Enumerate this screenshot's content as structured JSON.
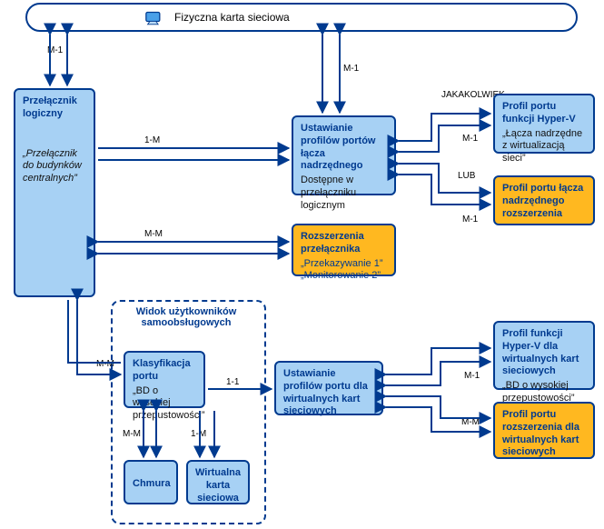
{
  "top": {
    "label": "Fizyczna karta sieciowa"
  },
  "boxes": {
    "logicalSwitch": {
      "title": "Przełącznik logiczny",
      "sub": "„Przełącznik do budynków centralnych”"
    },
    "uplinkSettings": {
      "title": "Ustawianie profilów portów łącza nadrzędnego",
      "sub": "Dostępne w przełączniku logicznym"
    },
    "extensions": {
      "title": "Rozszerzenia przełącznika",
      "sub": "„Przekazywanie 1” „Monitorowanie 2”"
    },
    "hyperVUplink": {
      "title": "Profil portu funkcji Hyper-V",
      "sub": "„Łącza nadrzędne z wirtualizacją sieci”"
    },
    "extUplink": {
      "title": "Profil portu łącza nadrzędnego rozszerzenia"
    },
    "portClass": {
      "title": "Klasyfikacja portu",
      "sub": "„BD o wysokiej przepustowości”"
    },
    "vnicSettings": {
      "title": "Ustawianie profilów portu dla wirtualnych kart sieciowych"
    },
    "hyperVVnic": {
      "title": "Profil funkcji Hyper-V dla wirtualnych kart sieciowych",
      "sub": "„BD o wysokiej przepustowości”"
    },
    "extVnic": {
      "title": "Profil portu rozszerzenia dla wirtualnych kart sieciowych"
    },
    "cloud": {
      "title": "Chmura"
    },
    "vnic": {
      "title": "Wirtualna karta sieciowa"
    }
  },
  "group": {
    "label": "Widok użytkowników samoobsługowych"
  },
  "edgeLabels": {
    "m1a": "M-1",
    "m1b": "M-1",
    "oneM_ls_uplink": "1-M",
    "mm_ls_ext": "M-M",
    "mm_ls_class": "M-M",
    "jakakolwiek": "JAKAKOLWIEK",
    "m1_hypervUp": "M-1",
    "lub": "LUB",
    "m1_extUp": "M-1",
    "oneOne_class_vset": "1-1",
    "m1_vHyperV": "M-1",
    "mm_vExt": "M-M",
    "mm_class_cloud": "M-M",
    "oneM_class_vnic": "1-M"
  }
}
